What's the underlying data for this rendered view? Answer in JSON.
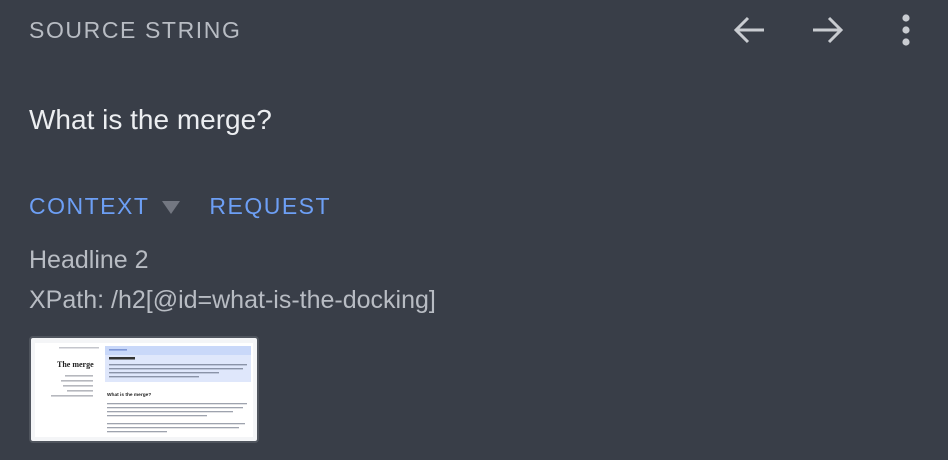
{
  "header": {
    "title": "SOURCE STRING",
    "back_icon": "arrow-left-icon",
    "forward_icon": "arrow-right-icon",
    "menu_icon": "more-vert-icon"
  },
  "source": {
    "text": "What is the merge?"
  },
  "tabs": [
    {
      "label": "CONTEXT",
      "has_dropdown": true
    },
    {
      "label": "REQUEST",
      "has_dropdown": false
    }
  ],
  "context": {
    "element_type": "Headline 2",
    "xpath": "XPath: /h2[@id=what-is-the-docking]"
  },
  "screenshot": {
    "page_title": "The merge",
    "heading": "What is the merge?"
  },
  "colors": {
    "background": "#393e48",
    "muted_text": "#b8bcc3",
    "primary_text": "#eceef1",
    "accent": "#6d9ff5",
    "icon": "#c9ccd1"
  }
}
